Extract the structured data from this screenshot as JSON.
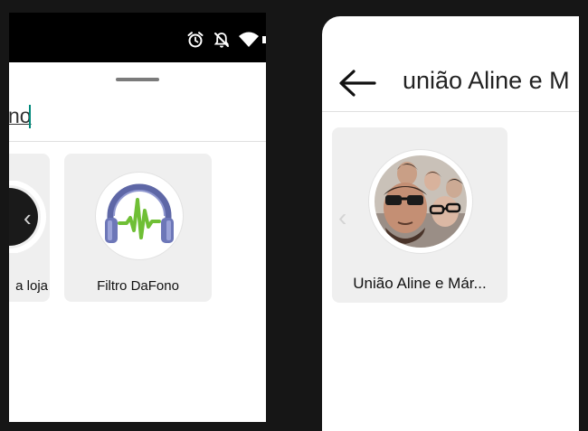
{
  "left_screen": {
    "status_icons": [
      "alarm-icon",
      "notifications-off-icon",
      "wifi-icon"
    ],
    "search": {
      "value": "no"
    },
    "results": [
      {
        "label": "a loja",
        "chevron": "‹"
      },
      {
        "label": "Filtro DaFono",
        "icon": "headphones-music-icon"
      }
    ]
  },
  "right_screen": {
    "back_icon": "arrow-left-icon",
    "title": "união Aline e M",
    "results": [
      {
        "label": "União Aline e Már...",
        "chevron": "‹",
        "icon": "group-photo-avatar"
      }
    ]
  },
  "colors": {
    "background": "#161616",
    "card": "#efefef",
    "caret": "#00897b",
    "waveform": "#6fbf35",
    "headphones": "#6d77b8"
  }
}
